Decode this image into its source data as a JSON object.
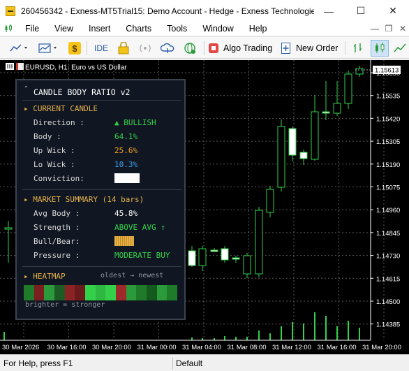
{
  "window": {
    "title": "260456342 - Exness-MT5Trial15: Demo Account - Hedge - Exness Technologie...",
    "min": "—",
    "max": "☐",
    "close": "✕"
  },
  "menu": [
    "File",
    "View",
    "Insert",
    "Charts",
    "Tools",
    "Window",
    "Help"
  ],
  "toolbar": {
    "ide": "IDE",
    "algo_trading": "Algo Trading",
    "new_order": "New Order"
  },
  "chart": {
    "symbol_label": "EURUSD, H1:  Euro vs US Dollar",
    "current_price": "1.15613",
    "price_ticks": [
      "1.15650",
      "1.15535",
      "1.15420",
      "1.15305",
      "1.15190",
      "1.15075",
      "1.14960",
      "1.14845",
      "1.14730",
      "1.14615",
      "1.14500",
      "1.14385"
    ],
    "time_ticks": [
      "30 Mar 2026",
      "30 Mar 16:00",
      "30 Mar 20:00",
      "31 Mar 00:00",
      "31 Mar 04:00",
      "31 Mar 08:00",
      "31 Mar 12:00",
      "31 Mar 16:00",
      "31 Mar 20:00"
    ]
  },
  "panel": {
    "title": "CANDLE BODY RATIO v2",
    "current_header": "CURRENT CANDLE",
    "direction_label": "Direction   :",
    "direction_value": "▲ BULLISH",
    "body_label": "Body        :",
    "body_value": "64.1%",
    "upwick_label": "Up Wick     :",
    "upwick_value": "25.6%",
    "lowick_label": "Lo Wick     :",
    "lowick_value": "10.3%",
    "conviction_label": "Conviction:",
    "summary_header": "MARKET SUMMARY (14 bars)",
    "avgbody_label": "Avg Body    :",
    "avgbody_value": "45.8%",
    "strength_label": "Strength  :",
    "strength_value": "ABOVE AVG ↑",
    "bullbear_label": "Bull/Bear:",
    "pressure_label": "Pressure  :",
    "pressure_value": "MODERATE BUY",
    "heatmap_header": "HEATMAP",
    "heatmap_order": "oldest → newest",
    "heatmap_note": "brighter = stronger",
    "colors": {
      "bull": "#33d14a",
      "up_wick": "#f0a020",
      "lo_wick": "#3a9ff0",
      "header": "#e5b24a"
    }
  },
  "status": {
    "help": "For Help, press F1",
    "profile": "Default"
  }
}
